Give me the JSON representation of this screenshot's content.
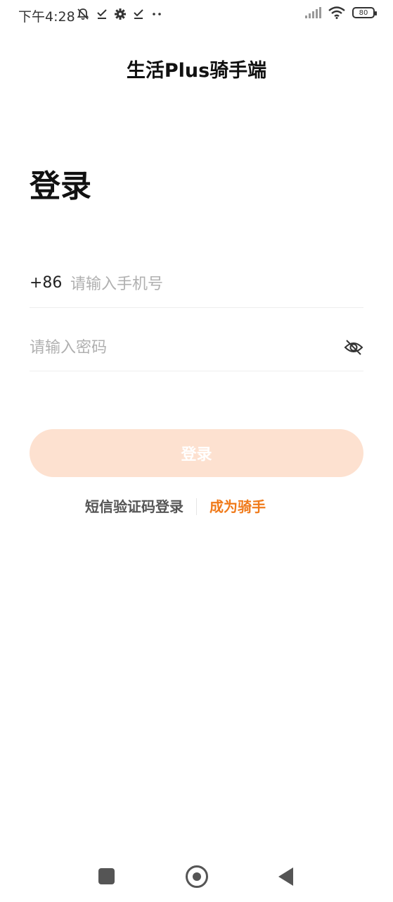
{
  "status_bar": {
    "time": "下午4:28",
    "battery_level": "80",
    "icons_left": [
      "bell-mute-icon",
      "check-icon",
      "gear-icon",
      "check-icon",
      "more-dots-icon"
    ],
    "icons_right": [
      "signal-icon",
      "wifi-icon",
      "battery-icon"
    ]
  },
  "app": {
    "title": "生活Plus骑手端"
  },
  "login": {
    "heading": "登录",
    "country_code": "+86",
    "phone_placeholder": "请输入手机号",
    "password_placeholder": "请输入密码",
    "submit_label": "登录"
  },
  "links": {
    "sms_login": "短信验证码登录",
    "become_rider": "成为骑手"
  },
  "colors": {
    "accent": "#f07a1a",
    "button_disabled_bg": "#fde1d0",
    "text_primary": "#111111",
    "placeholder": "#b0b0b0"
  },
  "nav_bar": {
    "icons": [
      "recent-apps-icon",
      "home-icon",
      "back-icon"
    ]
  }
}
